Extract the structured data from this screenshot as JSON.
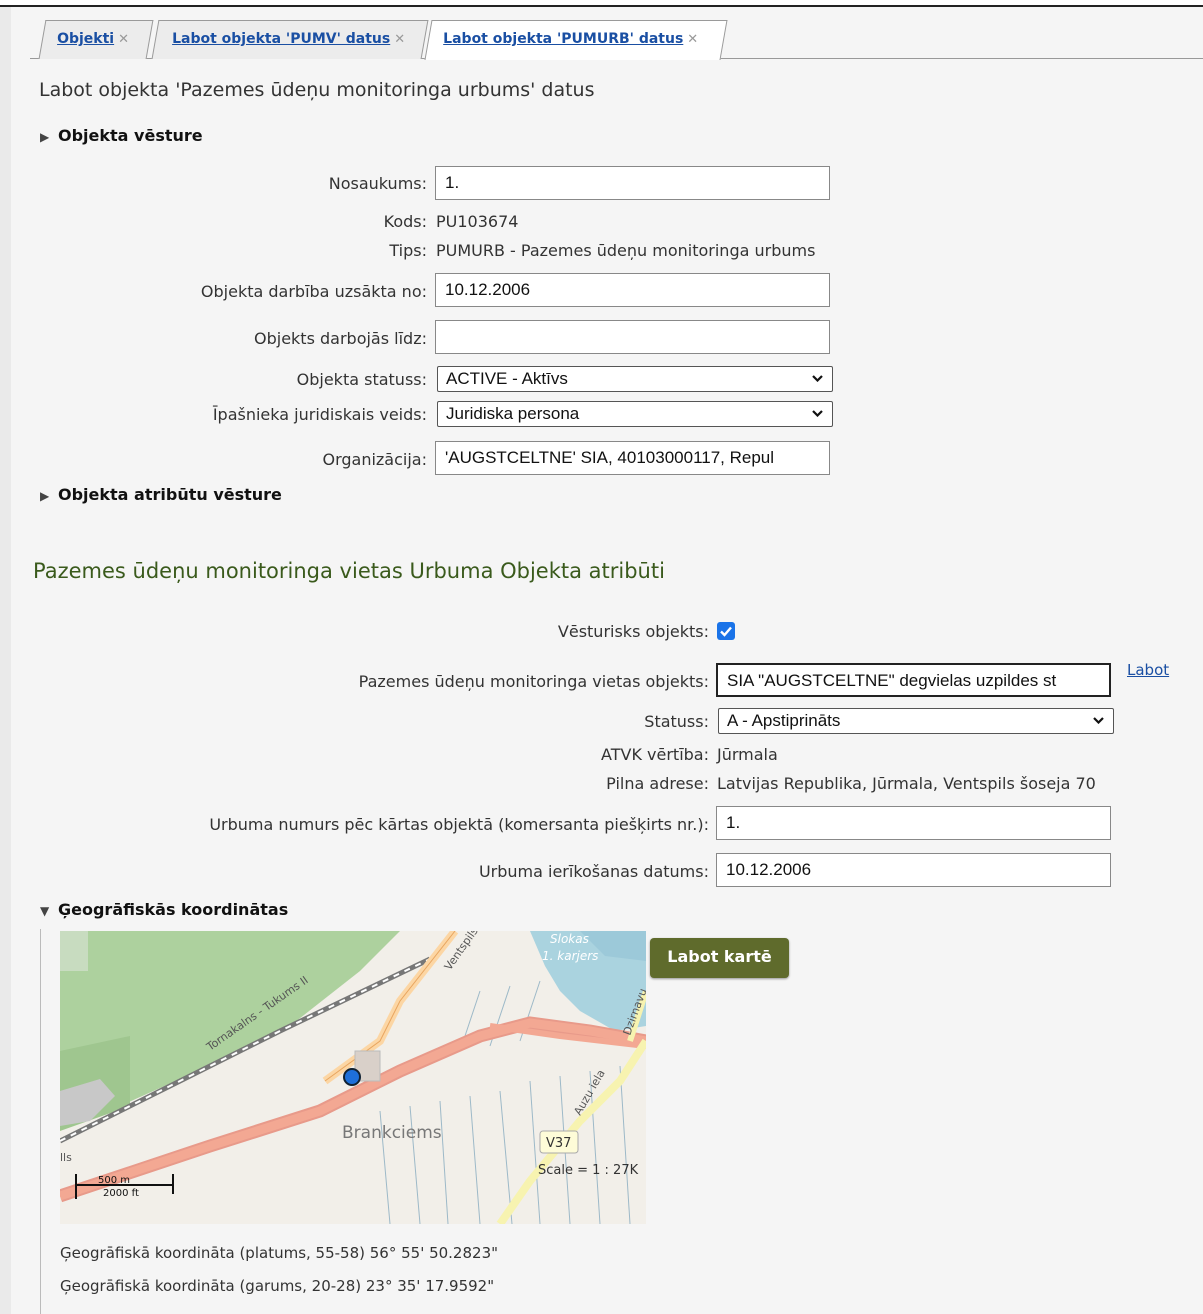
{
  "tabs": [
    {
      "label": "Objekti",
      "close": "✕"
    },
    {
      "label": "Labot objekta 'PUMV' datus",
      "close": "✕"
    },
    {
      "label": "Labot objekta 'PUMURB' datus",
      "close": "✕"
    }
  ],
  "page_title": "Labot objekta 'Pazemes ūdeņu monitoringa urbums' datus",
  "history": {
    "object_history": "Objekta vēsture",
    "attr_history": "Objekta atribūtu vēsture"
  },
  "form": {
    "name_label": "Nosaukums:",
    "name_value": "1.",
    "code_label": "Kods:",
    "code_value": "PU103674",
    "type_label": "Tips:",
    "type_value": "PUMURB - Pazemes ūdeņu monitoringa urbums",
    "start_label": "Objekta darbība uzsākta no:",
    "start_value": "10.12.2006",
    "end_label": "Objekts darbojās līdz:",
    "end_value": "",
    "status_label": "Objekta statuss:",
    "status_value": "ACTIVE - Aktīvs",
    "owner_label": "Īpašnieka juridiskais veids:",
    "owner_value": "Juridiska persona",
    "org_label": "Organizācija:",
    "org_value": "'AUGSTCELTNE' SIA, 40103000117, Repul"
  },
  "attributes": {
    "section_title": "Pazemes ūdeņu monitoringa vietas Urbuma Objekta atribūti",
    "historic_label": "Vēsturisks objekts:",
    "historic_checked": true,
    "site_label": "Pazemes ūdeņu monitoringa vietas objekts:",
    "site_value": "SIA \"AUGSTCELTNE\" degvielas uzpildes st",
    "edit_link": "Labot",
    "status_label": "Statuss:",
    "status_value": "A - Apstiprināts",
    "atvk_label": "ATVK vērtība:",
    "atvk_value": "Jūrmala",
    "address_label": "Pilna adrese:",
    "address_value": "Latvijas Republika, Jūrmala, Ventspils šoseja 70",
    "well_no_label": "Urbuma numurs pēc kārtas objektā (komersanta piešķirts nr.):",
    "well_no_value": "1.",
    "well_date_label": "Urbuma ierīkošanas datums:",
    "well_date_value": "10.12.2006"
  },
  "geo": {
    "title": "Ģeogrāfiskās koordinātas",
    "edit_button": "Labot kartē",
    "map_labels": {
      "slokas": "Slokas",
      "karjers": "1. karjers",
      "brankciems": "Brankciems",
      "road": "V37",
      "scale": "Scale = 1 : 27K",
      "scale_m": "500 m",
      "scale_ft": "2000 ft",
      "rail": "Tornakalns - Tukums II",
      "ventspils": "Ventspils",
      "auzu": "Auzu iela",
      "dzirnavu": "Dzirnavu",
      "lls": "lls"
    },
    "lat_text": "Ģeogrāfiskā koordināta (platums, 55-58) 56° 55' 50.2823\"",
    "lon_text": "Ģeogrāfiskā koordināta (garums, 20-28) 23° 35' 17.9592\""
  }
}
